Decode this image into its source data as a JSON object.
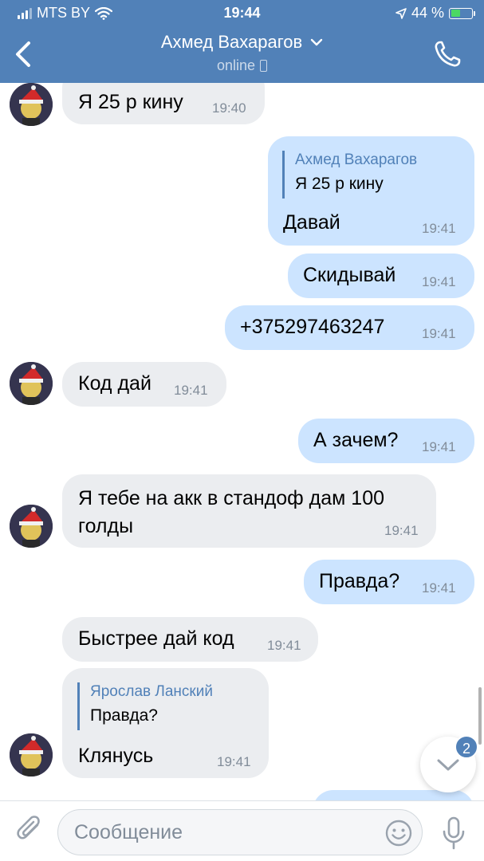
{
  "status_bar": {
    "carrier": "MTS BY",
    "time": "19:44",
    "battery": "44 %",
    "battery_level": 0.44
  },
  "header": {
    "name": "Ахмед Вахарагов",
    "status": "online"
  },
  "messages": [
    {
      "dir": "in",
      "text": "Я 25 р кину",
      "time": "19:40"
    },
    {
      "dir": "out",
      "reply_name": "Ахмед Вахарагов",
      "reply_text": "Я 25 р кину",
      "text": "Давай",
      "time": "19:41"
    },
    {
      "dir": "out",
      "text": "Скидывай",
      "time": "19:41"
    },
    {
      "dir": "out",
      "text": "+375297463247",
      "time": "19:41"
    },
    {
      "dir": "in",
      "text": "Код дай",
      "time": "19:41"
    },
    {
      "dir": "out",
      "text": "А зачем?",
      "time": "19:41"
    },
    {
      "dir": "in",
      "text_line1": "Я тебе на акк в стандоф дам 100",
      "text_line2": "голды",
      "time": "19:41"
    },
    {
      "dir": "out",
      "text": "Правда?",
      "time": "19:41"
    },
    {
      "dir": "in",
      "text": "Быстрее дай код",
      "time": "19:41"
    },
    {
      "dir": "in",
      "reply_name": "Ярослав Ланский",
      "reply_text": "Правда?",
      "text": "Клянусь",
      "time": "19:41"
    }
  ],
  "unread_badge": "2",
  "composer": {
    "placeholder": "Сообщение"
  },
  "icons": [
    "signal-icon",
    "wifi-icon",
    "location-icon",
    "battery-icon",
    "back-icon",
    "chevron-down-icon",
    "mobile-icon",
    "phone-icon",
    "attach-icon",
    "emoji-icon",
    "mic-icon",
    "scroll-down-icon"
  ],
  "colors": {
    "header": "#5181b8",
    "incoming_bubble": "#ebedf0",
    "outgoing_bubble": "#cce4ff",
    "time": "#818c99",
    "accent": "#5181b8"
  }
}
